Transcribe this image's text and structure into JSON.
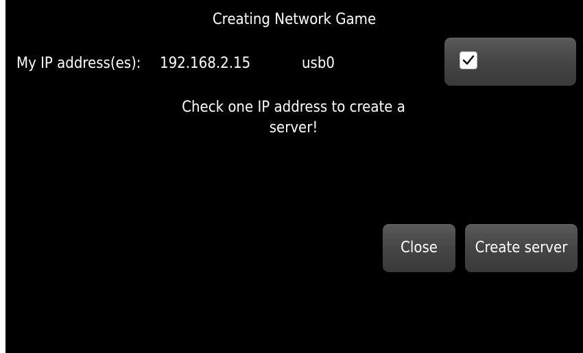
{
  "dialog": {
    "title": "Creating Network Game",
    "ip_label": "My IP address(es):",
    "ip_address": "192.168.2.15",
    "interface": "usb0",
    "ip_checked": true,
    "hint": "Check one IP address to create a server!"
  },
  "buttons": {
    "close_label": "Close",
    "create_label": "Create server"
  },
  "icons": {
    "checkbox": "checkmark-icon"
  },
  "colors": {
    "background": "#000000",
    "text": "#ffffff",
    "button": "#454545"
  }
}
